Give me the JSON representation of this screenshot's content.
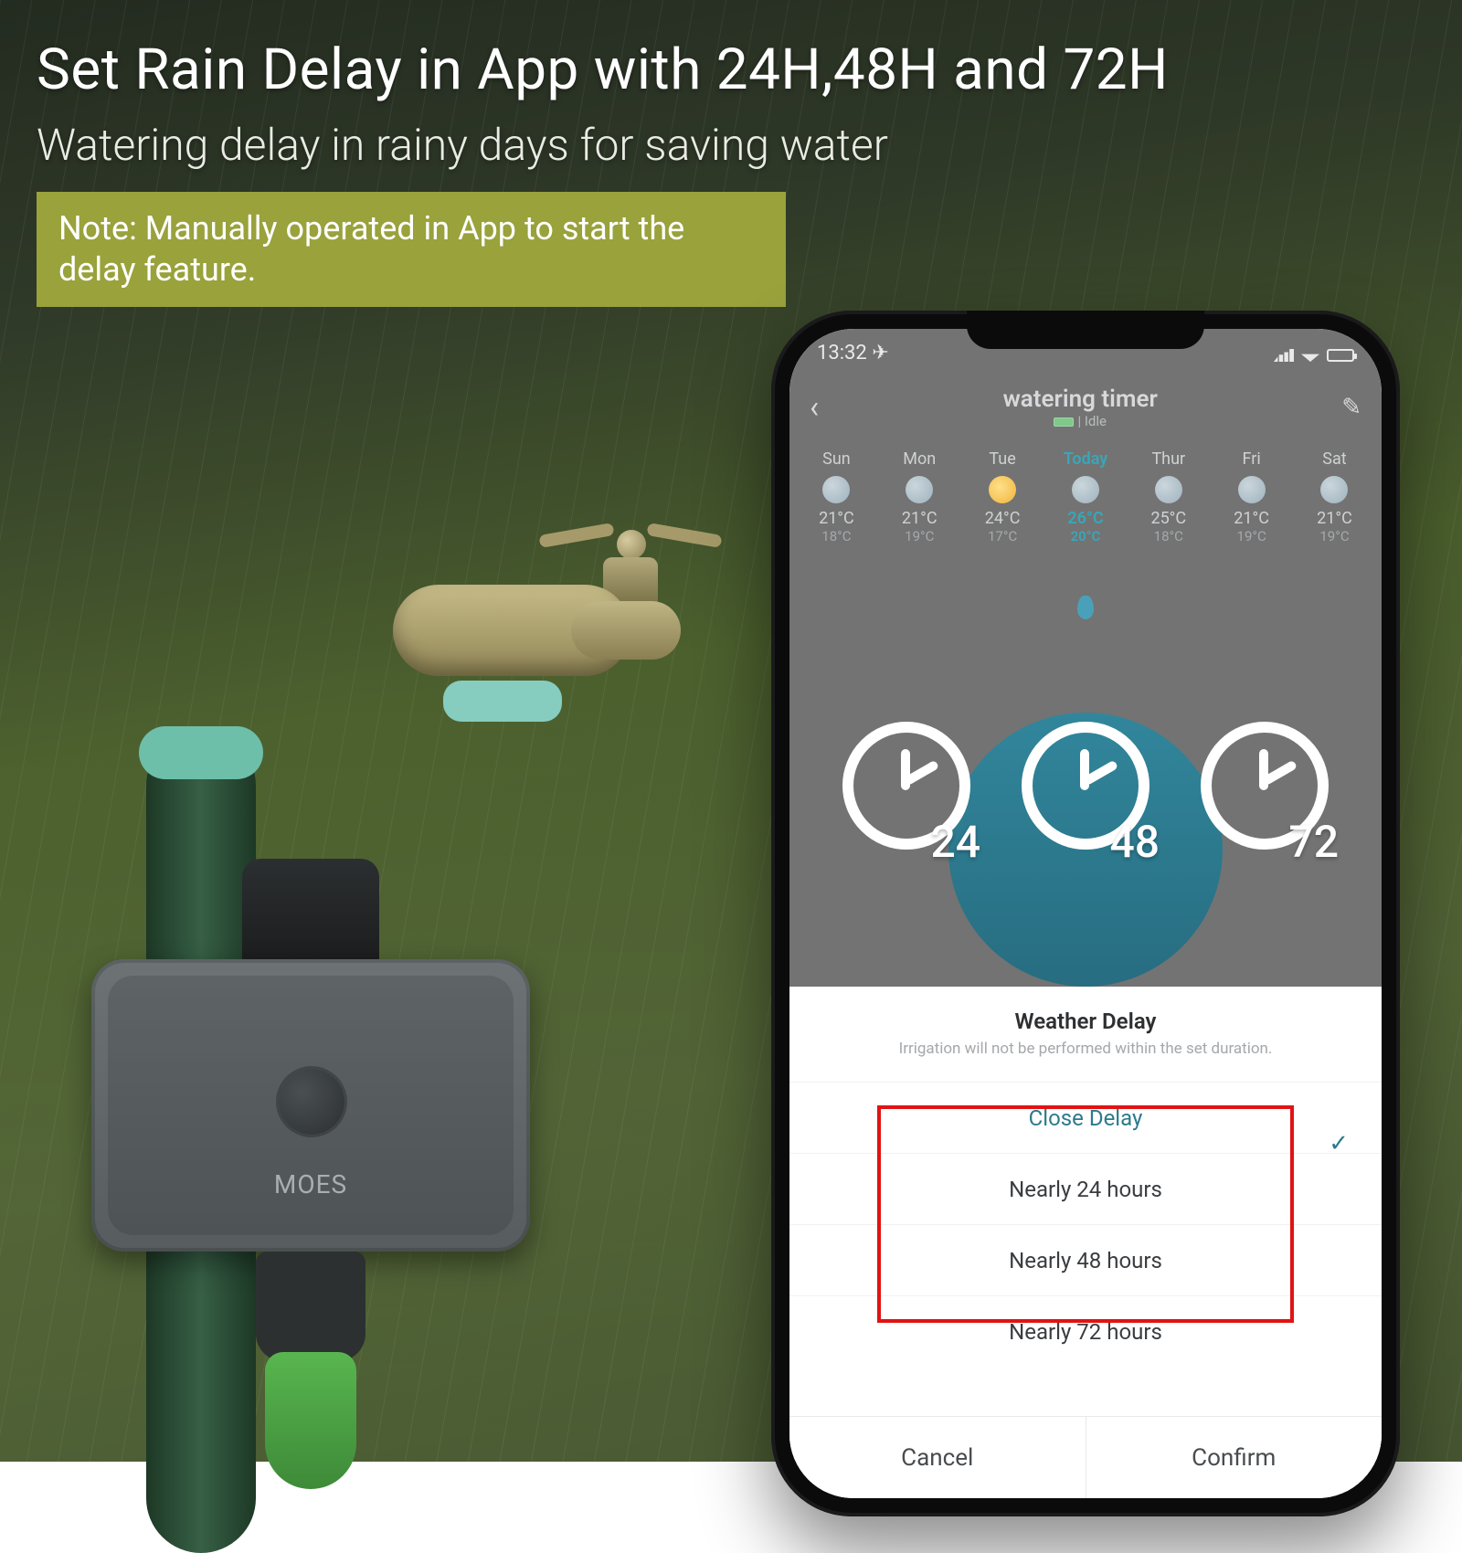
{
  "hero": {
    "title": "Set Rain Delay in App with 24H,48H and 72H",
    "subtitle": "Watering delay in rainy days for saving water",
    "note": "Note: Manually operated in App to start the delay feature."
  },
  "device": {
    "brand": "MOES"
  },
  "status": {
    "time": "13:32 ✈"
  },
  "app": {
    "title": "watering timer",
    "status": "Idle",
    "days": [
      {
        "label": "Sun",
        "hi": "21°C",
        "lo": "18°C",
        "today": false,
        "sun": false
      },
      {
        "label": "Mon",
        "hi": "21°C",
        "lo": "19°C",
        "today": false,
        "sun": false
      },
      {
        "label": "Tue",
        "hi": "24°C",
        "lo": "17°C",
        "today": false,
        "sun": true
      },
      {
        "label": "Today",
        "hi": "26°C",
        "lo": "20°C",
        "today": true,
        "sun": false
      },
      {
        "label": "Thur",
        "hi": "25°C",
        "lo": "18°C",
        "today": false,
        "sun": false
      },
      {
        "label": "Fri",
        "hi": "21°C",
        "lo": "19°C",
        "today": false,
        "sun": false
      },
      {
        "label": "Sat",
        "hi": "21°C",
        "lo": "19°C",
        "today": false,
        "sun": false
      }
    ]
  },
  "clocks": [
    "24",
    "48",
    "72"
  ],
  "sheet": {
    "title": "Weather Delay",
    "hint": "Irrigation will not be performed within the set duration.",
    "options": [
      "Close Delay",
      "Nearly 24 hours",
      "Nearly 48 hours",
      "Nearly 72 hours"
    ],
    "selected_index": 0,
    "cancel": "Cancel",
    "confirm": "Confirm"
  }
}
